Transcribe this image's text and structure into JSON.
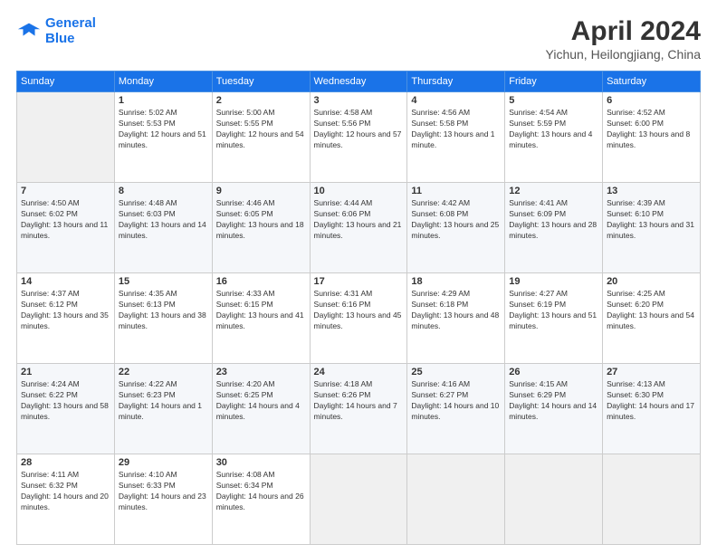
{
  "header": {
    "logo_line1": "General",
    "logo_line2": "Blue",
    "month": "April 2024",
    "location": "Yichun, Heilongjiang, China"
  },
  "days_of_week": [
    "Sunday",
    "Monday",
    "Tuesday",
    "Wednesday",
    "Thursday",
    "Friday",
    "Saturday"
  ],
  "weeks": [
    [
      {
        "day": "",
        "sunrise": "",
        "sunset": "",
        "daylight": ""
      },
      {
        "day": "1",
        "sunrise": "5:02 AM",
        "sunset": "5:53 PM",
        "daylight": "12 hours and 51 minutes."
      },
      {
        "day": "2",
        "sunrise": "5:00 AM",
        "sunset": "5:55 PM",
        "daylight": "12 hours and 54 minutes."
      },
      {
        "day": "3",
        "sunrise": "4:58 AM",
        "sunset": "5:56 PM",
        "daylight": "12 hours and 57 minutes."
      },
      {
        "day": "4",
        "sunrise": "4:56 AM",
        "sunset": "5:58 PM",
        "daylight": "13 hours and 1 minute."
      },
      {
        "day": "5",
        "sunrise": "4:54 AM",
        "sunset": "5:59 PM",
        "daylight": "13 hours and 4 minutes."
      },
      {
        "day": "6",
        "sunrise": "4:52 AM",
        "sunset": "6:00 PM",
        "daylight": "13 hours and 8 minutes."
      }
    ],
    [
      {
        "day": "7",
        "sunrise": "4:50 AM",
        "sunset": "6:02 PM",
        "daylight": "13 hours and 11 minutes."
      },
      {
        "day": "8",
        "sunrise": "4:48 AM",
        "sunset": "6:03 PM",
        "daylight": "13 hours and 14 minutes."
      },
      {
        "day": "9",
        "sunrise": "4:46 AM",
        "sunset": "6:05 PM",
        "daylight": "13 hours and 18 minutes."
      },
      {
        "day": "10",
        "sunrise": "4:44 AM",
        "sunset": "6:06 PM",
        "daylight": "13 hours and 21 minutes."
      },
      {
        "day": "11",
        "sunrise": "4:42 AM",
        "sunset": "6:08 PM",
        "daylight": "13 hours and 25 minutes."
      },
      {
        "day": "12",
        "sunrise": "4:41 AM",
        "sunset": "6:09 PM",
        "daylight": "13 hours and 28 minutes."
      },
      {
        "day": "13",
        "sunrise": "4:39 AM",
        "sunset": "6:10 PM",
        "daylight": "13 hours and 31 minutes."
      }
    ],
    [
      {
        "day": "14",
        "sunrise": "4:37 AM",
        "sunset": "6:12 PM",
        "daylight": "13 hours and 35 minutes."
      },
      {
        "day": "15",
        "sunrise": "4:35 AM",
        "sunset": "6:13 PM",
        "daylight": "13 hours and 38 minutes."
      },
      {
        "day": "16",
        "sunrise": "4:33 AM",
        "sunset": "6:15 PM",
        "daylight": "13 hours and 41 minutes."
      },
      {
        "day": "17",
        "sunrise": "4:31 AM",
        "sunset": "6:16 PM",
        "daylight": "13 hours and 45 minutes."
      },
      {
        "day": "18",
        "sunrise": "4:29 AM",
        "sunset": "6:18 PM",
        "daylight": "13 hours and 48 minutes."
      },
      {
        "day": "19",
        "sunrise": "4:27 AM",
        "sunset": "6:19 PM",
        "daylight": "13 hours and 51 minutes."
      },
      {
        "day": "20",
        "sunrise": "4:25 AM",
        "sunset": "6:20 PM",
        "daylight": "13 hours and 54 minutes."
      }
    ],
    [
      {
        "day": "21",
        "sunrise": "4:24 AM",
        "sunset": "6:22 PM",
        "daylight": "13 hours and 58 minutes."
      },
      {
        "day": "22",
        "sunrise": "4:22 AM",
        "sunset": "6:23 PM",
        "daylight": "14 hours and 1 minute."
      },
      {
        "day": "23",
        "sunrise": "4:20 AM",
        "sunset": "6:25 PM",
        "daylight": "14 hours and 4 minutes."
      },
      {
        "day": "24",
        "sunrise": "4:18 AM",
        "sunset": "6:26 PM",
        "daylight": "14 hours and 7 minutes."
      },
      {
        "day": "25",
        "sunrise": "4:16 AM",
        "sunset": "6:27 PM",
        "daylight": "14 hours and 10 minutes."
      },
      {
        "day": "26",
        "sunrise": "4:15 AM",
        "sunset": "6:29 PM",
        "daylight": "14 hours and 14 minutes."
      },
      {
        "day": "27",
        "sunrise": "4:13 AM",
        "sunset": "6:30 PM",
        "daylight": "14 hours and 17 minutes."
      }
    ],
    [
      {
        "day": "28",
        "sunrise": "4:11 AM",
        "sunset": "6:32 PM",
        "daylight": "14 hours and 20 minutes."
      },
      {
        "day": "29",
        "sunrise": "4:10 AM",
        "sunset": "6:33 PM",
        "daylight": "14 hours and 23 minutes."
      },
      {
        "day": "30",
        "sunrise": "4:08 AM",
        "sunset": "6:34 PM",
        "daylight": "14 hours and 26 minutes."
      },
      {
        "day": "",
        "sunrise": "",
        "sunset": "",
        "daylight": ""
      },
      {
        "day": "",
        "sunrise": "",
        "sunset": "",
        "daylight": ""
      },
      {
        "day": "",
        "sunrise": "",
        "sunset": "",
        "daylight": ""
      },
      {
        "day": "",
        "sunrise": "",
        "sunset": "",
        "daylight": ""
      }
    ]
  ]
}
